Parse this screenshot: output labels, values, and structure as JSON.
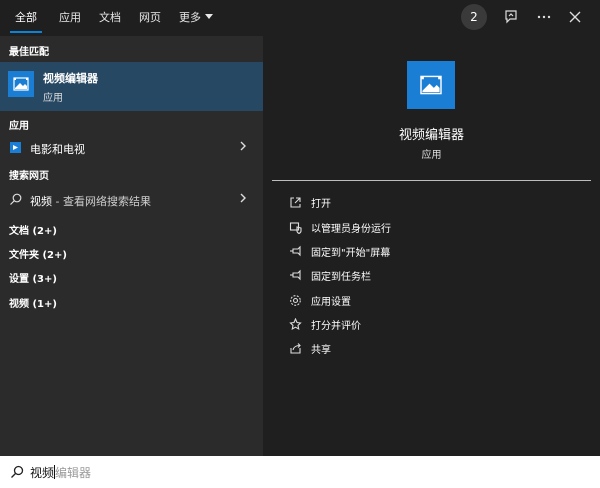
{
  "tabs": [
    {
      "label": "全部"
    },
    {
      "label": "应用"
    },
    {
      "label": "文档"
    },
    {
      "label": "网页"
    },
    {
      "label": "更多"
    }
  ],
  "topbar": {
    "badge": "2"
  },
  "left": {
    "best_match_header": "最佳匹配",
    "best_match": {
      "name": "视频编辑器",
      "type": "应用"
    },
    "apps_header": "应用",
    "apps": [
      {
        "label": "电影和电视"
      }
    ],
    "web_header": "搜索网页",
    "web": {
      "query": "视频",
      "suffix": " - 查看网络搜索结果"
    },
    "categories": [
      {
        "label": "文档 (2+)"
      },
      {
        "label": "文件夹 (2+)"
      },
      {
        "label": "设置 (3+)"
      },
      {
        "label": "视频 (1+)"
      }
    ]
  },
  "right": {
    "title": "视频编辑器",
    "subtitle": "应用",
    "actions": [
      {
        "label": "打开",
        "icon": "open-icon"
      },
      {
        "label": "以管理员身份运行",
        "icon": "shield-icon"
      },
      {
        "label": "固定到\"开始\"屏幕",
        "icon": "pin-icon"
      },
      {
        "label": "固定到任务栏",
        "icon": "pin-icon"
      },
      {
        "label": "应用设置",
        "icon": "gear-icon"
      },
      {
        "label": "打分并评价",
        "icon": "rate-icon"
      },
      {
        "label": "共享",
        "icon": "share-icon"
      }
    ]
  },
  "search": {
    "typed": "视频",
    "hint": "编辑器"
  },
  "colors": {
    "accent": "#0a84d8",
    "app_icon": "#1a7fd4",
    "selected_bg": "#264863"
  }
}
